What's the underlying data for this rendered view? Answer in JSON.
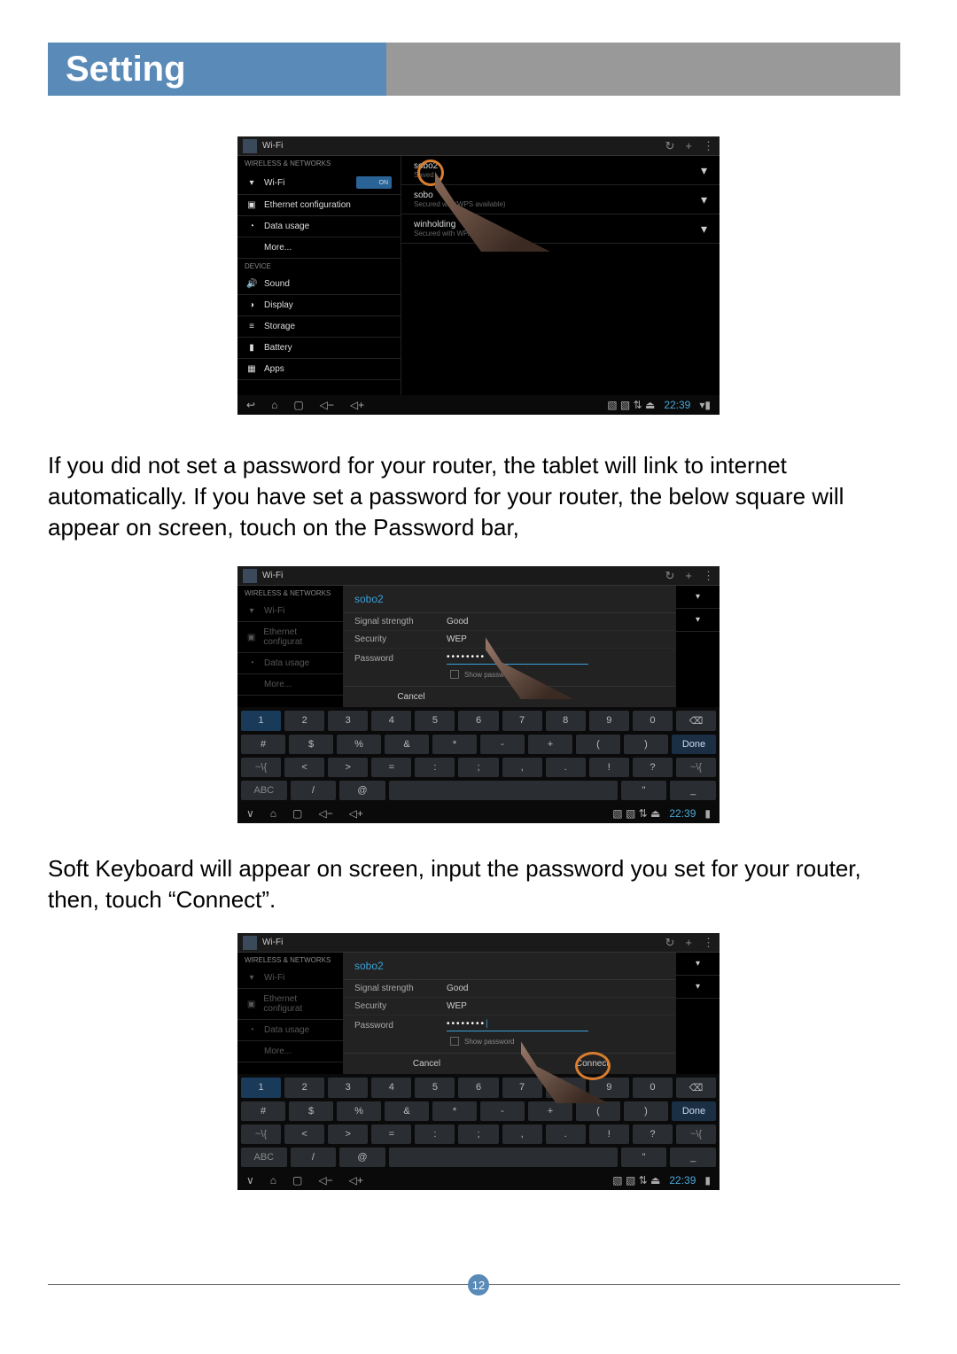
{
  "page": {
    "title": "Setting",
    "number": "12"
  },
  "paragraphs": {
    "p1": "If you did not set a password for your router, the tablet will link to internet automatically. If you have set a password for your router, the below square will appear on screen, touch on the Password bar,",
    "p2": "Soft Keyboard will appear on screen, input the password you set for your router, then, touch “Connect”."
  },
  "screenshot_common": {
    "app_title": "Wi-Fi",
    "topbar_icons": [
      "↻",
      "+",
      "⋮"
    ],
    "sidebar_header": "WIRELESS & NETWORKS",
    "sidebar_device_header": "DEVICE",
    "wifi_label": "Wi-Fi",
    "wifi_toggle": "ON",
    "ethernet_label": "Ethernet configuration",
    "datausage_label": "Data usage",
    "more_label": "More...",
    "sound_label": "Sound",
    "display_label": "Display",
    "storage_label": "Storage",
    "battery_label": "Battery",
    "apps_label": "Apps",
    "nav_time": "22:39"
  },
  "screenshot1": {
    "networks": [
      {
        "name": "sobo2",
        "sub": "Saved"
      },
      {
        "name": "sobo",
        "sub": "Secured w...    (WPS available)"
      },
      {
        "name": "winholding",
        "sub": "Secured with WPA2"
      }
    ]
  },
  "dialog": {
    "network_name": "sobo2",
    "signal_label": "Signal strength",
    "signal_value": "Good",
    "security_label": "Security",
    "security_value": "WEP",
    "password_label": "Password",
    "password_masked": "••••••••",
    "show_password": "Show password",
    "cancel": "Cancel",
    "connect": "Connect"
  },
  "keyboard": {
    "row1": [
      "1",
      "2",
      "3",
      "4",
      "5",
      "6",
      "7",
      "8",
      "9",
      "0",
      "⌫"
    ],
    "row2": [
      "#",
      "$",
      "%",
      "&",
      "*",
      "-",
      "+",
      "(",
      ")",
      "Done"
    ],
    "row3": [
      "~\\{",
      "<",
      ">",
      "=",
      ":",
      ";",
      ",",
      ".",
      "!",
      "?",
      "~\\{"
    ],
    "row4": [
      "ABC",
      "/",
      "@",
      "",
      "\"",
      "_"
    ]
  }
}
